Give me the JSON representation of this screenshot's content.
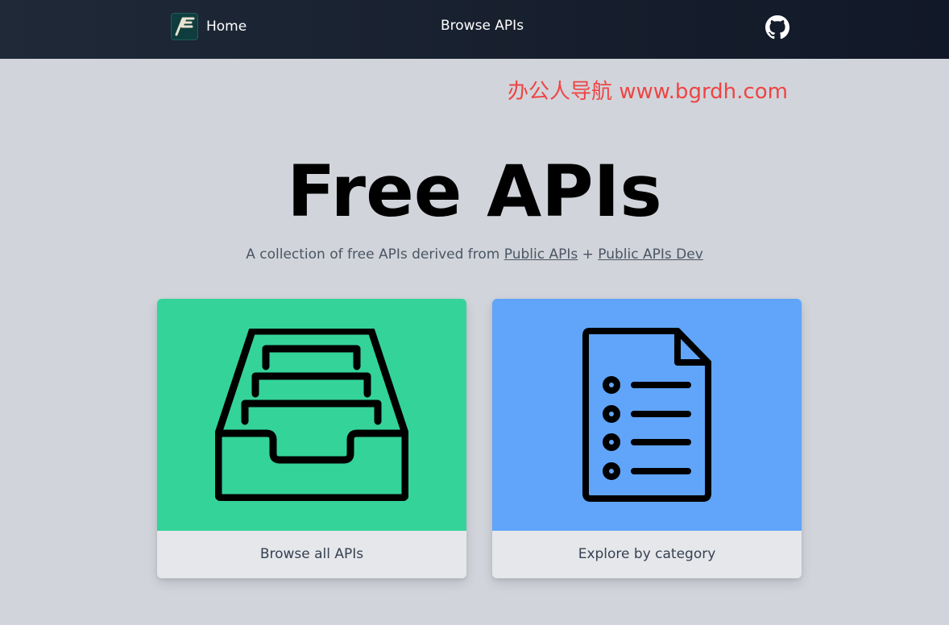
{
  "nav": {
    "home_label": "Home",
    "logo_text": "AF",
    "browse_label": "Browse APIs",
    "github_icon": "github-icon"
  },
  "watermark": "办公人导航 www.bgrdh.com",
  "hero": {
    "title": "Free APIs",
    "subtitle_prefix": "A collection of free APIs derived from",
    "link1": "Public APIs",
    "separator": "+",
    "link2": "Public APIs Dev"
  },
  "cards": [
    {
      "label": "Browse all APIs",
      "icon": "file-drawer-icon",
      "color": "#34d399"
    },
    {
      "label": "Explore by category",
      "icon": "document-list-icon",
      "color": "#60a5fa"
    }
  ],
  "colors": {
    "nav_bg": "#1f2937",
    "page_bg": "#d1d5db",
    "watermark": "#ef4444"
  }
}
